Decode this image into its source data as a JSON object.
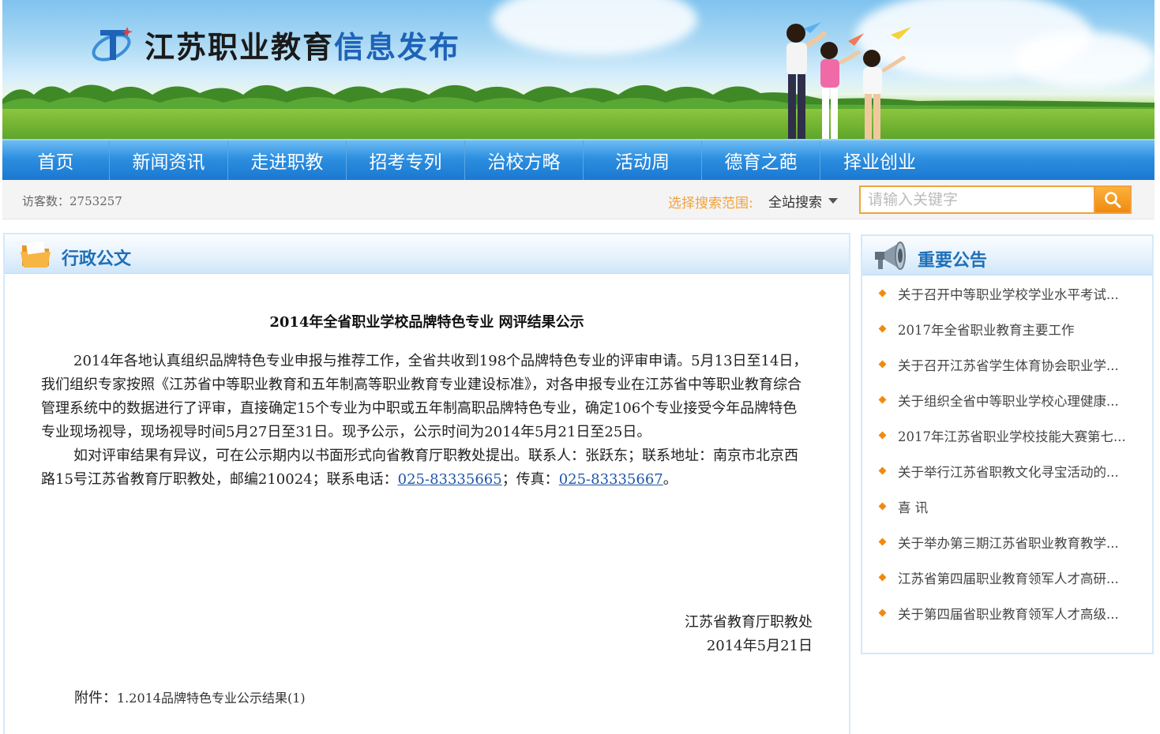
{
  "site": {
    "logo_text_black": "江苏职业教育",
    "logo_text_blue": "信息发布"
  },
  "nav": {
    "items": [
      {
        "label": "首页"
      },
      {
        "label": "新闻资讯"
      },
      {
        "label": "走进职教"
      },
      {
        "label": "招考专列"
      },
      {
        "label": "治校方略"
      },
      {
        "label": "活动周"
      },
      {
        "label": "德育之葩"
      },
      {
        "label": "择业创业"
      }
    ]
  },
  "infobar": {
    "visitor_label": "访客数：",
    "visitor_count": "2753257",
    "scope_label": "选择搜索范围:",
    "scope_value": "全站搜索",
    "search_placeholder": "请输入关键字",
    "search_icon": "search-icon"
  },
  "main": {
    "section_title": "行政公文",
    "section_icon": "folder-icon",
    "article": {
      "title": "2014年全省职业学校品牌特色专业 网评结果公示",
      "paragraph1": "2014年各地认真组织品牌特色专业申报与推荐工作，全省共收到198个品牌特色专业的评审申请。5月13日至14日，我们组织专家按照《江苏省中等职业教育和五年制高等职业教育专业建设标准》，对各申报专业在江苏省中等职业教育综合管理系统中的数据进行了评审，直接确定15个专业为中职或五年制高职品牌特色专业，确定106个专业接受今年品牌特色专业现场视导，现场视导时间5月27日至31日。现予公示，公示时间为2014年5月21日至25日。",
      "paragraph2_prefix": "如对评审结果有异议，可在公示期内以书面形式向省教育厅职教处提出。联系人：张跃东；联系地址：南京市北京西路15号江苏省教育厅职教处，邮编210024；联系电话：",
      "phone": "025-83335665",
      "fax_label": "；传真：",
      "fax": "025-83335667",
      "paragraph2_suffix": "。",
      "signature_org": "江苏省教育厅职教处",
      "signature_date": "2014年5月21日",
      "attachment_label": "附件：",
      "attachment_link": "1.2014品牌特色专业公示结果(1)"
    }
  },
  "sidebar": {
    "title": "重要公告",
    "icon": "megaphone-icon",
    "notices": [
      {
        "text": "关于召开中等职业学校学业水平考试..."
      },
      {
        "text": "2017年全省职业教育主要工作"
      },
      {
        "text": "关于召开江苏省学生体育协会职业学..."
      },
      {
        "text": "关于组织全省中等职业学校心理健康..."
      },
      {
        "text": "2017年江苏省职业学校技能大赛第七..."
      },
      {
        "text": "关于举行江苏省职教文化寻宝活动的..."
      },
      {
        "text": "喜  讯"
      },
      {
        "text": "关于举办第三期江苏省职业教育教学..."
      },
      {
        "text": "江苏省第四届职业教育领军人才高研..."
      },
      {
        "text": "关于第四届省职业教育领军人才高级..."
      }
    ]
  },
  "colors": {
    "nav_blue": "#2d8fe0",
    "brand_blue": "#1e63b8",
    "accent_orange": "#f2a23b",
    "heading_blue": "#1f6fb8"
  }
}
